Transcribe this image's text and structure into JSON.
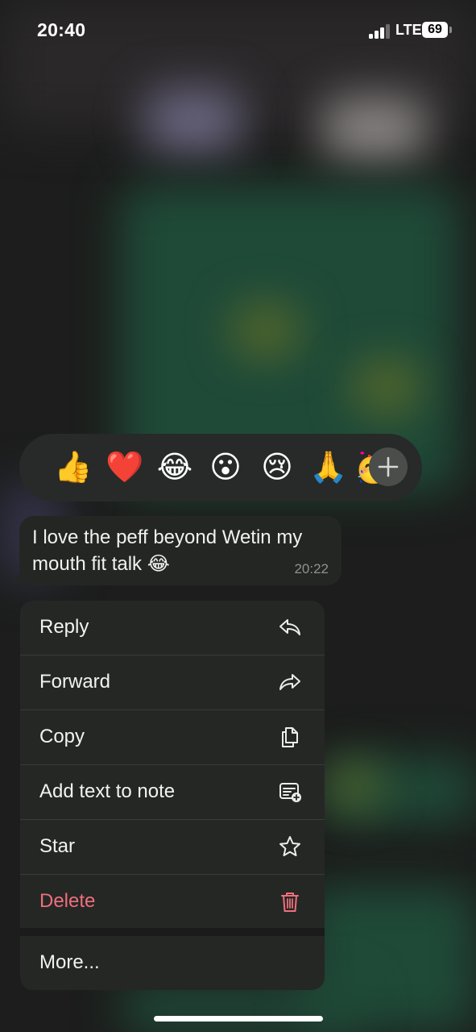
{
  "status_bar": {
    "time": "20:40",
    "network": "LTE",
    "battery": "69",
    "signal_bars": 3,
    "signal_icon": "cellular-signal-icon",
    "battery_icon": "battery-icon"
  },
  "reactions": {
    "emojis": [
      "👍",
      "❤️",
      "😂",
      "😮",
      "😢",
      "🙏",
      "🥳"
    ],
    "add_icon": "plus-icon"
  },
  "message": {
    "text": "I love the peff beyond Wetin my mouth fit talk 😂",
    "time": "20:22",
    "bubble_color": "#242624"
  },
  "menu": {
    "items": [
      {
        "label": "Reply",
        "icon": "reply-icon"
      },
      {
        "label": "Forward",
        "icon": "forward-icon"
      },
      {
        "label": "Copy",
        "icon": "copy-icon"
      },
      {
        "label": "Add text to note",
        "icon": "add-note-icon"
      },
      {
        "label": "Star",
        "icon": "star-icon"
      },
      {
        "label": "Delete",
        "icon": "trash-icon"
      }
    ],
    "more_label": "More...",
    "danger_color": "#ef6f7c"
  }
}
